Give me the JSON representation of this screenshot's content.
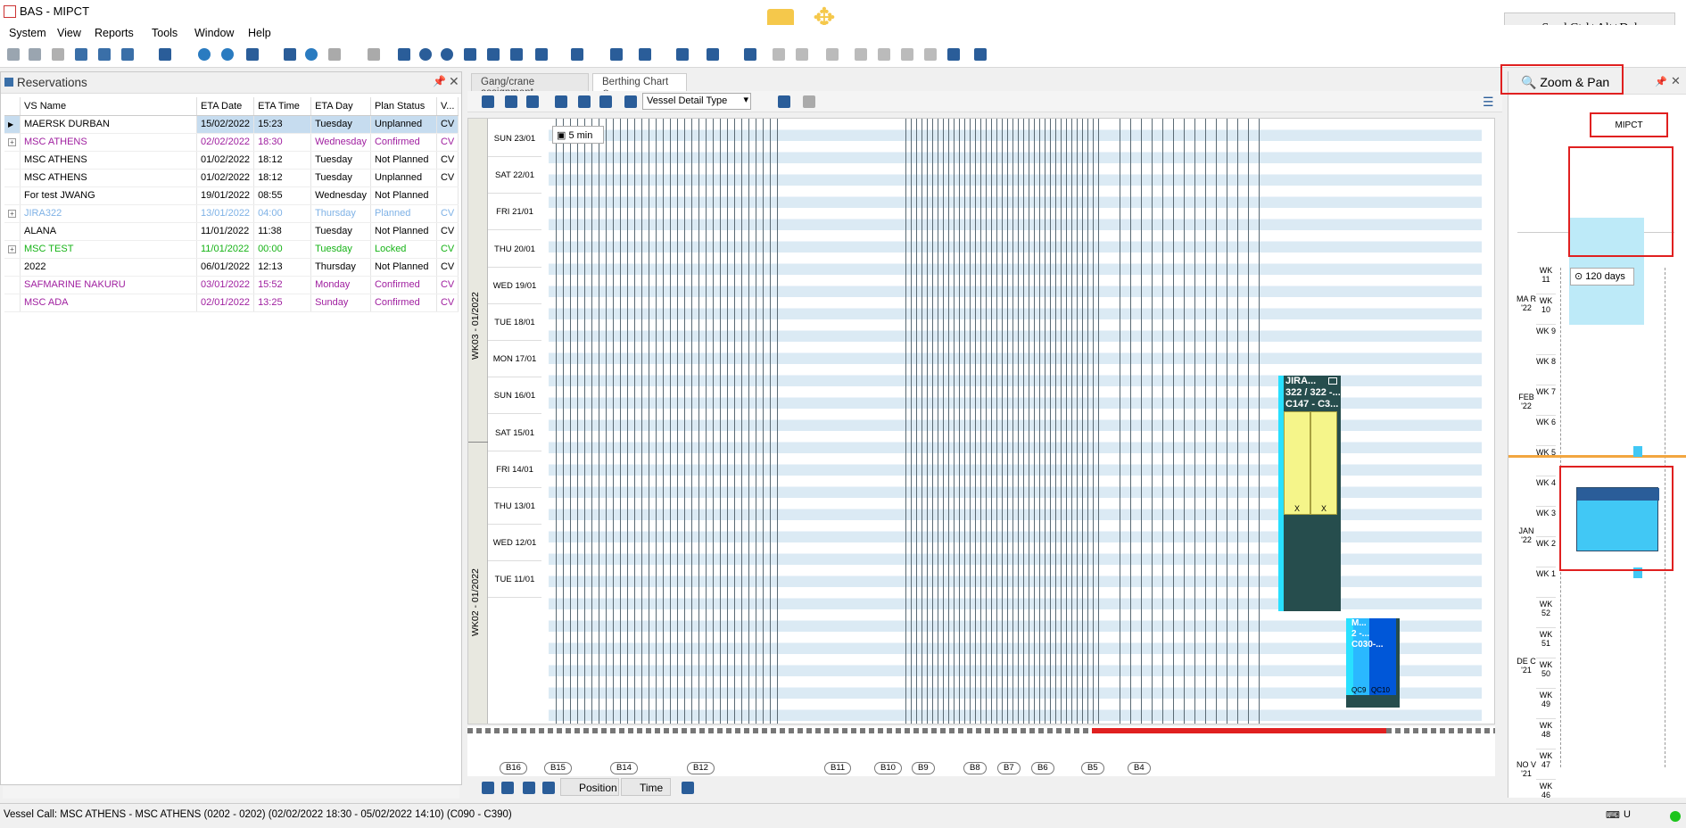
{
  "window": {
    "title": "BAS - MIPCT",
    "send_cad": "Send Ctrl+Alt+Del"
  },
  "menu": [
    "System",
    "View",
    "Reports",
    "Tools",
    "Window",
    "Help"
  ],
  "reservations": {
    "title": "Reservations",
    "columns": [
      "VS Name",
      "ETA Date",
      "ETA Time",
      "ETA Day",
      "Plan Status",
      "V..."
    ],
    "rows": [
      {
        "expand": "",
        "name": "MAERSK DURBAN",
        "date": "15/02/2022",
        "time": "15:23",
        "day": "Tuesday",
        "status": "Unplanned",
        "v": "CV",
        "color": "#000000",
        "selected": true
      },
      {
        "expand": "+",
        "name": "MSC ATHENS",
        "date": "02/02/2022",
        "time": "18:30",
        "day": "Wednesday",
        "status": "Confirmed",
        "v": "CV",
        "color": "#a020a0",
        "selected": false
      },
      {
        "expand": "",
        "name": "MSC ATHENS",
        "date": "01/02/2022",
        "time": "18:12",
        "day": "Tuesday",
        "status": "Not Planned",
        "v": "CV",
        "color": "#000000",
        "selected": false
      },
      {
        "expand": "",
        "name": "MSC ATHENS",
        "date": "01/02/2022",
        "time": "18:12",
        "day": "Tuesday",
        "status": "Unplanned",
        "v": "CV",
        "color": "#000000",
        "selected": false
      },
      {
        "expand": "",
        "name": "For test JWANG",
        "date": "19/01/2022",
        "time": "08:55",
        "day": "Wednesday",
        "status": "Not Planned",
        "v": "",
        "color": "#000000",
        "selected": false
      },
      {
        "expand": "+",
        "name": "JIRA322",
        "date": "13/01/2022",
        "time": "04:00",
        "day": "Thursday",
        "status": "Planned",
        "v": "CV",
        "color": "#7fb2e6",
        "selected": false
      },
      {
        "expand": "",
        "name": "ALANA",
        "date": "11/01/2022",
        "time": "11:38",
        "day": "Tuesday",
        "status": "Not Planned",
        "v": "CV",
        "color": "#000000",
        "selected": false
      },
      {
        "expand": "+",
        "name": "MSC TEST",
        "date": "11/01/2022",
        "time": "00:00",
        "day": "Tuesday",
        "status": "Locked",
        "v": "CV",
        "color": "#16b316",
        "selected": false
      },
      {
        "expand": "",
        "name": "2022",
        "date": "06/01/2022",
        "time": "12:13",
        "day": "Thursday",
        "status": "Not Planned",
        "v": "CV",
        "color": "#000000",
        "selected": false
      },
      {
        "expand": "",
        "name": "SAFMARINE NAKURU",
        "date": "03/01/2022",
        "time": "15:52",
        "day": "Monday",
        "status": "Confirmed",
        "v": "CV",
        "color": "#a020a0",
        "selected": false
      },
      {
        "expand": "",
        "name": "MSC ADA",
        "date": "02/01/2022",
        "time": "13:25",
        "day": "Sunday",
        "status": "Confirmed",
        "v": "CV",
        "color": "#a020a0",
        "selected": false
      }
    ]
  },
  "tabs": [
    "Gang/crane assignment",
    "Berthing Chart"
  ],
  "chart_toolbar": {
    "vessel_detail_type": "Vessel Detail Type",
    "interval": "5 min"
  },
  "chart": {
    "days": [
      "SUN 23/01",
      "SAT 22/01",
      "FRI 21/01",
      "THU 20/01",
      "WED 19/01",
      "TUE 18/01",
      "MON 17/01",
      "SUN 16/01",
      "SAT 15/01",
      "FRI 14/01",
      "THU 13/01",
      "WED 12/01",
      "TUE 11/01"
    ],
    "weeks": [
      "WK03 - 01/2022",
      "WK02 - 01/2022"
    ],
    "vessels": [
      {
        "label_line1": "JIRA...",
        "label_line2": "322 / 322 -...",
        "label_line3": "C147 - C3...",
        "crane_mark_1": "X",
        "crane_mark_2": "X"
      },
      {
        "label_line1": "M...",
        "label_line2": "2 -...",
        "label_line3": "C030-...",
        "crane_1": "QC9",
        "crane_2": "QC10"
      }
    ],
    "berths": [
      "B16",
      "B15",
      "B14",
      "B12",
      "B11",
      "B10",
      "B9",
      "B8",
      "B7",
      "B6",
      "B5",
      "B4"
    ]
  },
  "bottom_toolbar": {
    "position": "Position",
    "time": "Time"
  },
  "zoom_pan": {
    "title": "Zoom & Pan",
    "terminal": "MIPCT",
    "days": "120 days",
    "months": [
      {
        "label": "MA R '22"
      },
      {
        "label": "FEB '22"
      },
      {
        "label": "JAN '22"
      },
      {
        "label": "DE C '21"
      },
      {
        "label": "NO V '21"
      }
    ],
    "weeks": [
      "WK 11",
      "WK 10",
      "WK 9",
      "WK 8",
      "WK 7",
      "WK 6",
      "WK 5",
      "WK 4",
      "WK 3",
      "WK 2",
      "WK 1",
      "WK 52",
      "WK 51",
      "WK 50",
      "WK 49",
      "WK 48",
      "WK 47",
      "WK 46"
    ]
  },
  "status": {
    "text": "Vessel Call: MSC ATHENS - MSC ATHENS (0202 - 0202) (02/02/2022 18:30 - 05/02/2022 14:10) (C090 - C390)",
    "lang": "U"
  }
}
